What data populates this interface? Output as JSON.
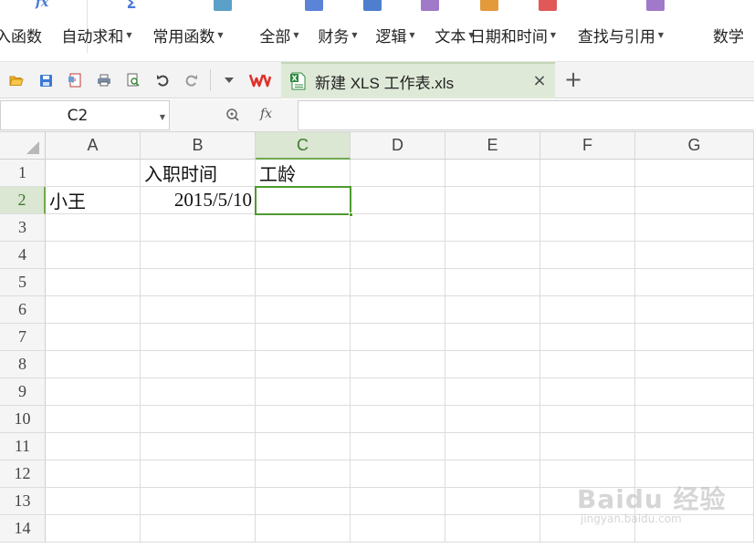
{
  "ribbon": {
    "items": [
      {
        "label": "插入函数",
        "dropdown": false,
        "icon": "function-icon",
        "color": "#4a7cd6"
      },
      {
        "label": "自动求和",
        "dropdown": true,
        "icon": "autosum-icon",
        "color": "#4a7cd6"
      },
      {
        "label": "常用函数",
        "dropdown": true,
        "icon": "star-icon",
        "color": "#5aa0c8"
      },
      {
        "label": "全部",
        "dropdown": true,
        "icon": "list-icon",
        "color": "#5b84d6"
      },
      {
        "label": "财务",
        "dropdown": true,
        "icon": "finance-icon",
        "color": "#4f7ecf"
      },
      {
        "label": "逻辑",
        "dropdown": true,
        "icon": "logic-icon",
        "color": "#a07ac8"
      },
      {
        "label": "文本",
        "dropdown": true,
        "icon": "text-icon",
        "color": "#e39a3a"
      },
      {
        "label": "日期和时间",
        "dropdown": true,
        "icon": "clock-icon",
        "color": "#e05858"
      },
      {
        "label": "查找与引用",
        "dropdown": true,
        "icon": "lookup-icon",
        "color": "#a07ac8"
      },
      {
        "label": "数学",
        "dropdown": false,
        "icon": "math-icon",
        "color": "#7aa54a"
      }
    ]
  },
  "toolbar": {
    "icons": [
      "open-icon",
      "save-icon",
      "export-pdf-icon",
      "print-icon",
      "print-preview-icon",
      "undo-icon",
      "redo-icon",
      "more-dropdown-icon"
    ]
  },
  "tab": {
    "title": "新建 XLS 工作表.xls",
    "close": "×",
    "new_tab": "+"
  },
  "formula_bar": {
    "name_box": "C2",
    "fx": "fx",
    "formula": ""
  },
  "sheet": {
    "columns": [
      "A",
      "B",
      "C",
      "D",
      "E",
      "F",
      "G"
    ],
    "rows": [
      "1",
      "2",
      "3",
      "4",
      "5",
      "6",
      "7",
      "8",
      "9",
      "10",
      "11",
      "12",
      "13",
      "14"
    ],
    "active_cell": "C2",
    "cells": {
      "B1": "入职时间",
      "C1": "工龄",
      "A2": "小王",
      "B2": "2015/5/10"
    }
  },
  "watermark": {
    "main": "Baidu 经验",
    "sub": "jingyan.baidu.com"
  },
  "colors": {
    "accent_green": "#4e9a2f",
    "tab_bg": "#dfe9d8",
    "wps_red": "#e0302b"
  }
}
